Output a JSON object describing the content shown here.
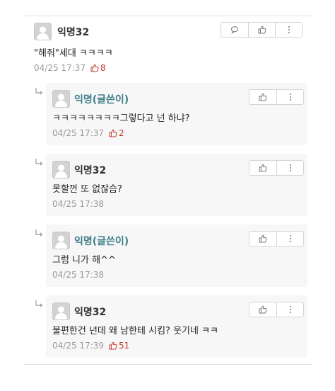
{
  "colors": {
    "like_count": "#c0392b",
    "author_writer": "#3f7f87",
    "reply_background": "#f7f7f7",
    "meta_text": "#9a9a9a"
  },
  "icons": {
    "reply_button": "speech-bubble-icon",
    "like_button": "thumbs-up-icon",
    "more_button": "vertical-dots-icon",
    "reply_indicator": "reply-arrow-icon",
    "avatar": "default-user-icon"
  },
  "comment": {
    "author": "익명32",
    "content": "\"해줘\"세대 ㅋㅋㅋㅋ",
    "timestamp": "04/25 17:37",
    "likes": "8"
  },
  "replies": [
    {
      "author": "익명(글쓴이)",
      "is_writer": true,
      "content": "ㅋㅋㅋㅋㅋㅋㅋㅋ그렇다고 넌 하냐?",
      "timestamp": "04/25 17:37",
      "likes": "2"
    },
    {
      "author": "익명32",
      "is_writer": false,
      "content": "못할껀 또 없잖슴?",
      "timestamp": "04/25 17:38",
      "likes": null
    },
    {
      "author": "익명(글쓴이)",
      "is_writer": true,
      "content": "그럼 니가 해^^",
      "timestamp": "04/25 17:38",
      "likes": null
    },
    {
      "author": "익명32",
      "is_writer": false,
      "content": "불편한건 넌데 왜 남한테 시킴? 웃기네 ㅋㅋ",
      "timestamp": "04/25 17:39",
      "likes": "51"
    }
  ]
}
